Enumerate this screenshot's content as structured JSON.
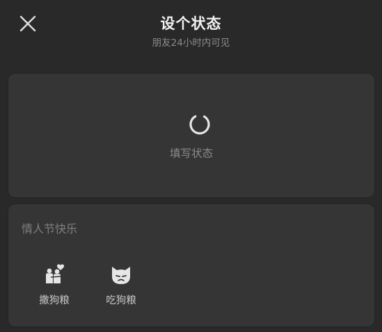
{
  "header": {
    "title": "设个状态",
    "subtitle": "朋友24小时内可见"
  },
  "input_card": {
    "label": "填写状态"
  },
  "category": {
    "title": "情人节快乐",
    "items": [
      {
        "label": "撒狗粮",
        "icon": "couple-hug-heart-icon"
      },
      {
        "label": "吃狗粮",
        "icon": "sad-cat-face-icon"
      }
    ]
  },
  "colors": {
    "background": "#292929",
    "card": "#353535",
    "title": "#f2f2f2",
    "muted": "#8a8a8a"
  }
}
